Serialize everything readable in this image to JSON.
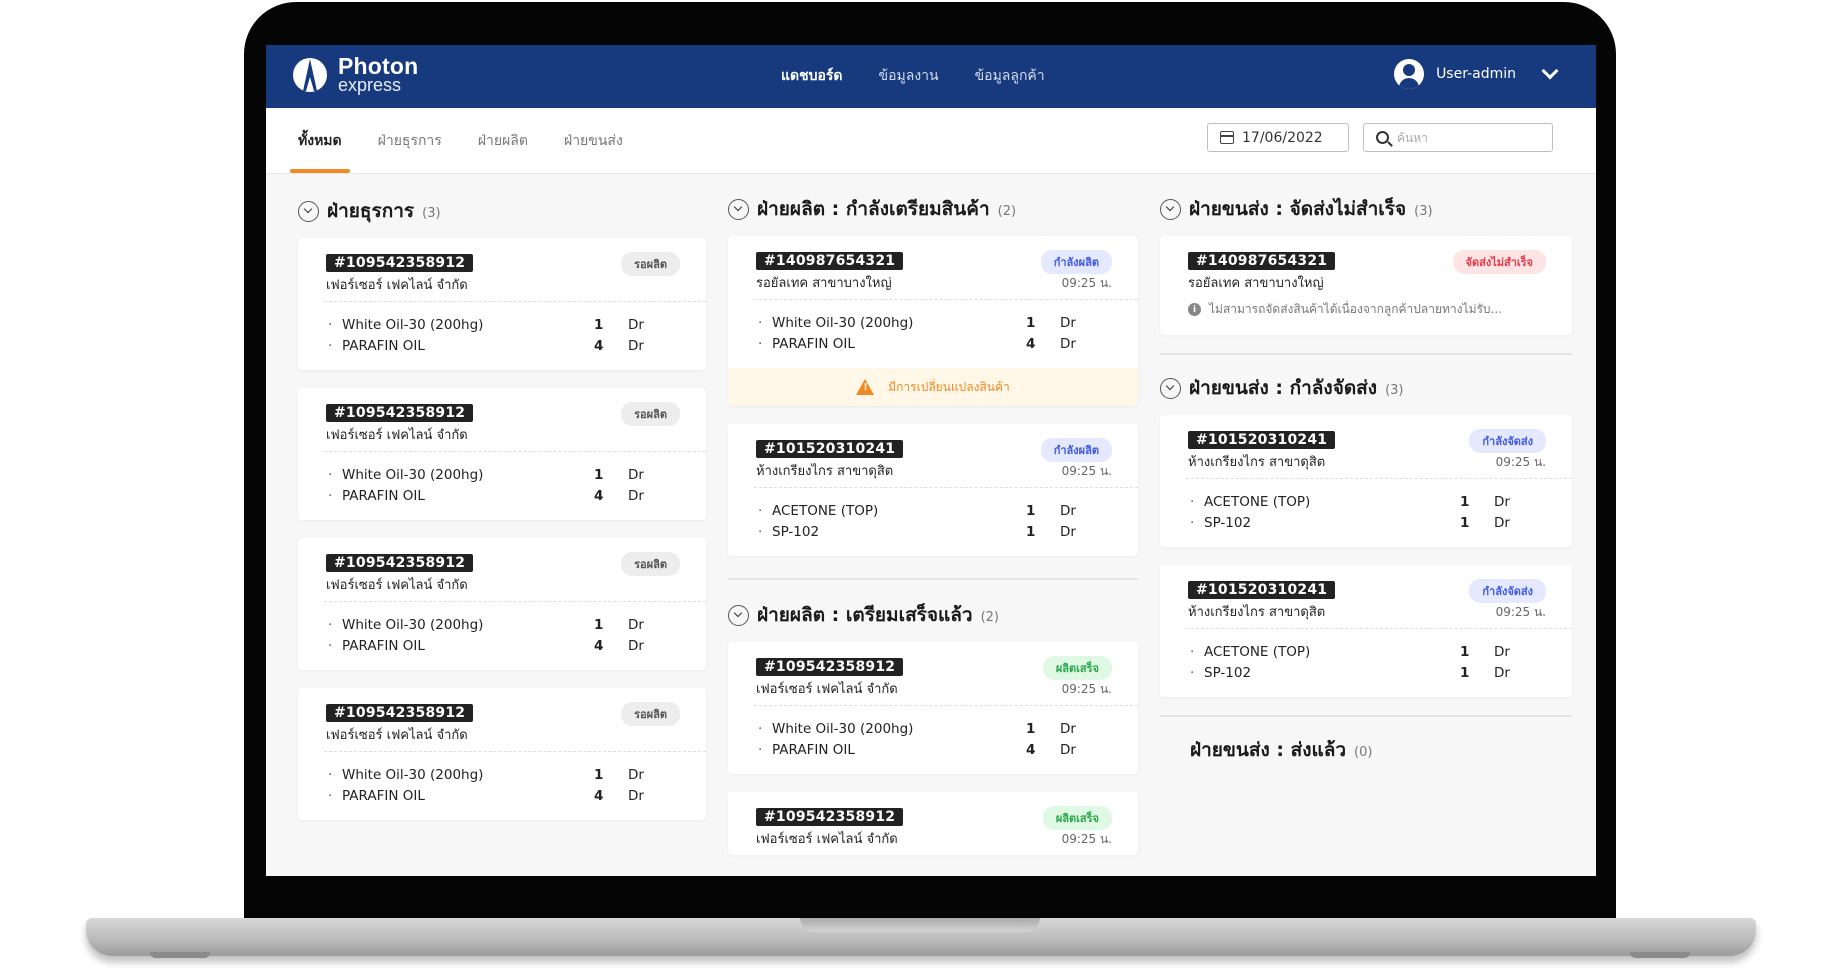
{
  "app": {
    "brand_title": "Photon",
    "brand_sub": "express"
  },
  "nav": {
    "links": [
      {
        "label": "แดชบอร์ด",
        "active": true
      },
      {
        "label": "ข้อมูลงาน",
        "active": false
      },
      {
        "label": "ข้อมูลลูกค้า",
        "active": false
      }
    ],
    "user": "User-admin"
  },
  "tabs": [
    {
      "label": "ทั้งหมด",
      "active": true
    },
    {
      "label": "ฝ่ายธุรการ",
      "active": false
    },
    {
      "label": "ฝ่ายผลิต",
      "active": false
    },
    {
      "label": "ฝ่ายขนส่ง",
      "active": false
    }
  ],
  "filters": {
    "date": "17/06/2022",
    "search_placeholder": "ค้นหา",
    "search_value": ""
  },
  "colors": {
    "nav": "#173a7f",
    "accent": "#f08a24"
  },
  "columns": [
    {
      "sections": [
        {
          "title": "ฝ่ายธุรการ",
          "count": "(3)",
          "cards": [
            {
              "id": "#109542358912",
              "customer": "เฟอร์เซอร์ เฟคไลน์ จำกัด",
              "badge": "รอผลิต",
              "badge_type": "wait",
              "time": "",
              "items": [
                {
                  "name": "White Oil-30 (200hg)",
                  "qty": "1",
                  "unit": "Dr"
                },
                {
                  "name": "PARAFIN OIL",
                  "qty": "4",
                  "unit": "Dr"
                }
              ]
            },
            {
              "id": "#109542358912",
              "customer": "เฟอร์เซอร์ เฟคไลน์ จำกัด",
              "badge": "รอผลิต",
              "badge_type": "wait",
              "time": "",
              "items": [
                {
                  "name": "White Oil-30 (200hg)",
                  "qty": "1",
                  "unit": "Dr"
                },
                {
                  "name": "PARAFIN OIL",
                  "qty": "4",
                  "unit": "Dr"
                }
              ]
            },
            {
              "id": "#109542358912",
              "customer": "เฟอร์เซอร์ เฟคไลน์ จำกัด",
              "badge": "รอผลิต",
              "badge_type": "wait",
              "time": "",
              "items": [
                {
                  "name": "White Oil-30 (200hg)",
                  "qty": "1",
                  "unit": "Dr"
                },
                {
                  "name": "PARAFIN OIL",
                  "qty": "4",
                  "unit": "Dr"
                }
              ]
            },
            {
              "id": "#109542358912",
              "customer": "เฟอร์เซอร์ เฟคไลน์ จำกัด",
              "badge": "รอผลิต",
              "badge_type": "wait",
              "time": "",
              "items": [
                {
                  "name": "White Oil-30 (200hg)",
                  "qty": "1",
                  "unit": "Dr"
                },
                {
                  "name": "PARAFIN OIL",
                  "qty": "4",
                  "unit": "Dr"
                }
              ]
            }
          ]
        }
      ]
    },
    {
      "sections": [
        {
          "title": "ฝ่ายผลิต : กำลังเตรียมสินค้า",
          "count": "(2)",
          "cards": [
            {
              "id": "#140987654321",
              "customer": "รอยัลเทค สาขาบางใหญ่",
              "badge": "กำลังผลิต",
              "badge_type": "prod",
              "time": "09:25 น.",
              "items": [
                {
                  "name": "White Oil-30 (200hg)",
                  "qty": "1",
                  "unit": "Dr"
                },
                {
                  "name": "PARAFIN OIL",
                  "qty": "4",
                  "unit": "Dr"
                }
              ],
              "warning": "มีการเปลี่ยนแปลงสินค้า"
            },
            {
              "id": "#101520310241",
              "customer": "ห้างเกรียงไกร สาขาดุสิต",
              "badge": "กำลังผลิต",
              "badge_type": "prod",
              "time": "09:25 น.",
              "items": [
                {
                  "name": "ACETONE (TOP)",
                  "qty": "1",
                  "unit": "Dr"
                },
                {
                  "name": "SP-102",
                  "qty": "1",
                  "unit": "Dr"
                }
              ]
            }
          ]
        },
        {
          "title": "ฝ่ายผลิต : เตรียมเสร็จแล้ว",
          "count": "(2)",
          "cards": [
            {
              "id": "#109542358912",
              "customer": "เฟอร์เซอร์ เฟคไลน์ จำกัด",
              "badge": "ผลิตเสร็จ",
              "badge_type": "done",
              "time": "09:25 น.",
              "items": [
                {
                  "name": "White Oil-30 (200hg)",
                  "qty": "1",
                  "unit": "Dr"
                },
                {
                  "name": "PARAFIN OIL",
                  "qty": "4",
                  "unit": "Dr"
                }
              ]
            },
            {
              "id": "#109542358912",
              "customer": "เฟอร์เซอร์ เฟคไลน์ จำกัด",
              "badge": "ผลิตเสร็จ",
              "badge_type": "done",
              "time": "09:25 น.",
              "items": []
            }
          ]
        }
      ]
    },
    {
      "sections": [
        {
          "title": "ฝ่ายขนส่ง : จัดส่งไม่สำเร็จ",
          "count": "(3)",
          "cards": [
            {
              "id": "#140987654321",
              "customer": "รอยัลเทค สาขาบางใหญ่",
              "badge": "จัดส่งไม่สำเร็จ",
              "badge_type": "fail",
              "time": "",
              "items": [],
              "note": "ไม่สามารถจัดส่งสินค้าได้เนื่องจากลูกค้าปลายทางไม่รับ..."
            }
          ]
        },
        {
          "title": "ฝ่ายขนส่ง : กำลังจัดส่ง",
          "count": "(3)",
          "cards": [
            {
              "id": "#101520310241",
              "customer": "ห้างเกรียงไกร สาขาดุสิต",
              "badge": "กำลังจัดส่ง",
              "badge_type": "ship",
              "time": "09:25 น.",
              "items": [
                {
                  "name": "ACETONE (TOP)",
                  "qty": "1",
                  "unit": "Dr"
                },
                {
                  "name": "SP-102",
                  "qty": "1",
                  "unit": "Dr"
                }
              ]
            },
            {
              "id": "#101520310241",
              "customer": "ห้างเกรียงไกร สาขาดุสิต",
              "badge": "กำลังจัดส่ง",
              "badge_type": "ship",
              "time": "09:25 น.",
              "items": [
                {
                  "name": "ACETONE (TOP)",
                  "qty": "1",
                  "unit": "Dr"
                },
                {
                  "name": "SP-102",
                  "qty": "1",
                  "unit": "Dr"
                }
              ]
            }
          ]
        },
        {
          "title": "ฝ่ายขนส่ง : ส่งแล้ว",
          "count": "(0)",
          "collapsible": false,
          "cards": []
        }
      ]
    }
  ]
}
